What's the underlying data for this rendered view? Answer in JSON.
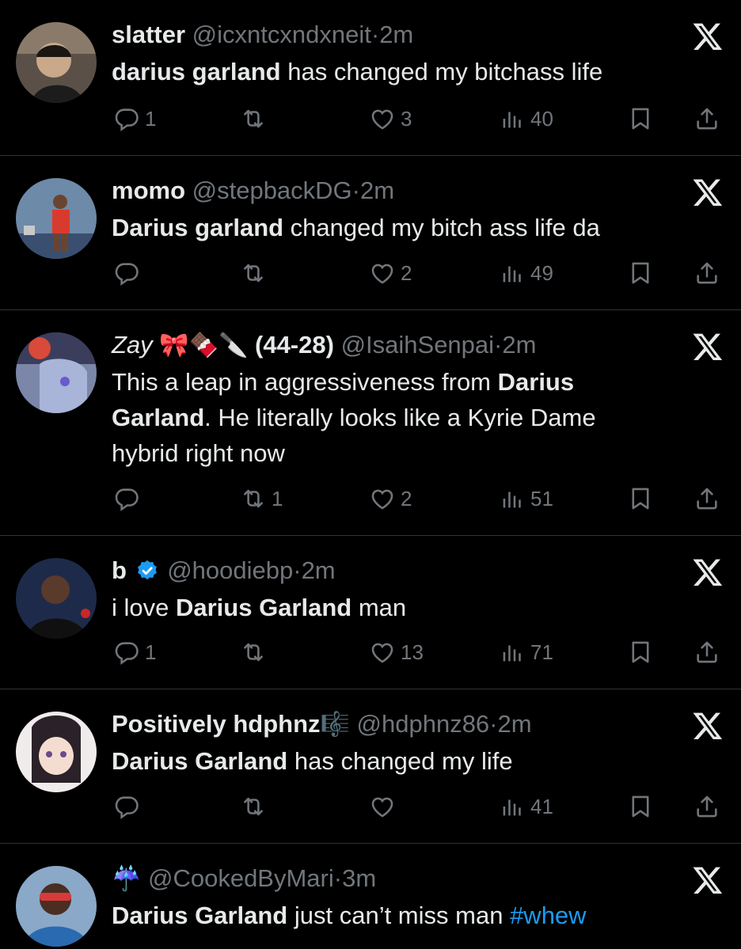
{
  "tweets": [
    {
      "name": "slatter",
      "handle": "@icxntcxndxneit",
      "dot": "·",
      "time": "2m",
      "text_bold": "darius garland",
      "text_rest": " has changed my bitchass life",
      "replies": "1",
      "retweets": "",
      "likes": "3",
      "views": "40"
    },
    {
      "name": "momo",
      "handle": "@stepbackDG",
      "dot": "·",
      "time": "2m",
      "text_bold": "Darius garland",
      "text_rest": " changed my bitch ass life da",
      "replies": "",
      "retweets": "",
      "likes": "2",
      "views": "49"
    },
    {
      "name": "Zay",
      "name_emoji": "🎀🍫🔪",
      "name_suffix": "(44-28)",
      "handle": "@IsaihSenpai",
      "dot": "·",
      "time": "2m",
      "text_pre": "This a leap in aggressiveness from ",
      "text_bold": "Darius Garland",
      "text_rest": ". He literally looks like a Kyrie Dame hybrid right now",
      "replies": "",
      "retweets": "1",
      "likes": "2",
      "views": "51"
    },
    {
      "name": "b",
      "handle": "@hoodiebp",
      "dot": "·",
      "time": "2m",
      "text_pre": "i love ",
      "text_bold": "Darius Garland",
      "text_rest": " man",
      "replies": "1",
      "retweets": "",
      "likes": "13",
      "views": "71"
    },
    {
      "name": "Positively hdphnz",
      "name_emoji": "🎼",
      "handle": "@hdphnz86",
      "dot": "·",
      "time": "2m",
      "text_bold": "Darius Garland",
      "text_rest": " has changed my life",
      "replies": "",
      "retweets": "",
      "likes": "",
      "views": "41"
    },
    {
      "name_emoji": "☔",
      "handle": "@CookedByMari",
      "dot": "·",
      "time": "3m",
      "text_bold": "Darius Garland",
      "text_rest": " just can’t miss man ",
      "hashtag": "#whew"
    }
  ],
  "colors": {
    "background": "#000000",
    "text": "#e7e9ea",
    "muted": "#71767b",
    "link": "#1d9bf0",
    "verified": "#1d9bf0",
    "divider": "#2f3336"
  },
  "icons": [
    "x-logo-icon",
    "reply-icon",
    "retweet-icon",
    "like-icon",
    "views-icon",
    "bookmark-icon",
    "share-icon",
    "verified-badge-icon"
  ]
}
